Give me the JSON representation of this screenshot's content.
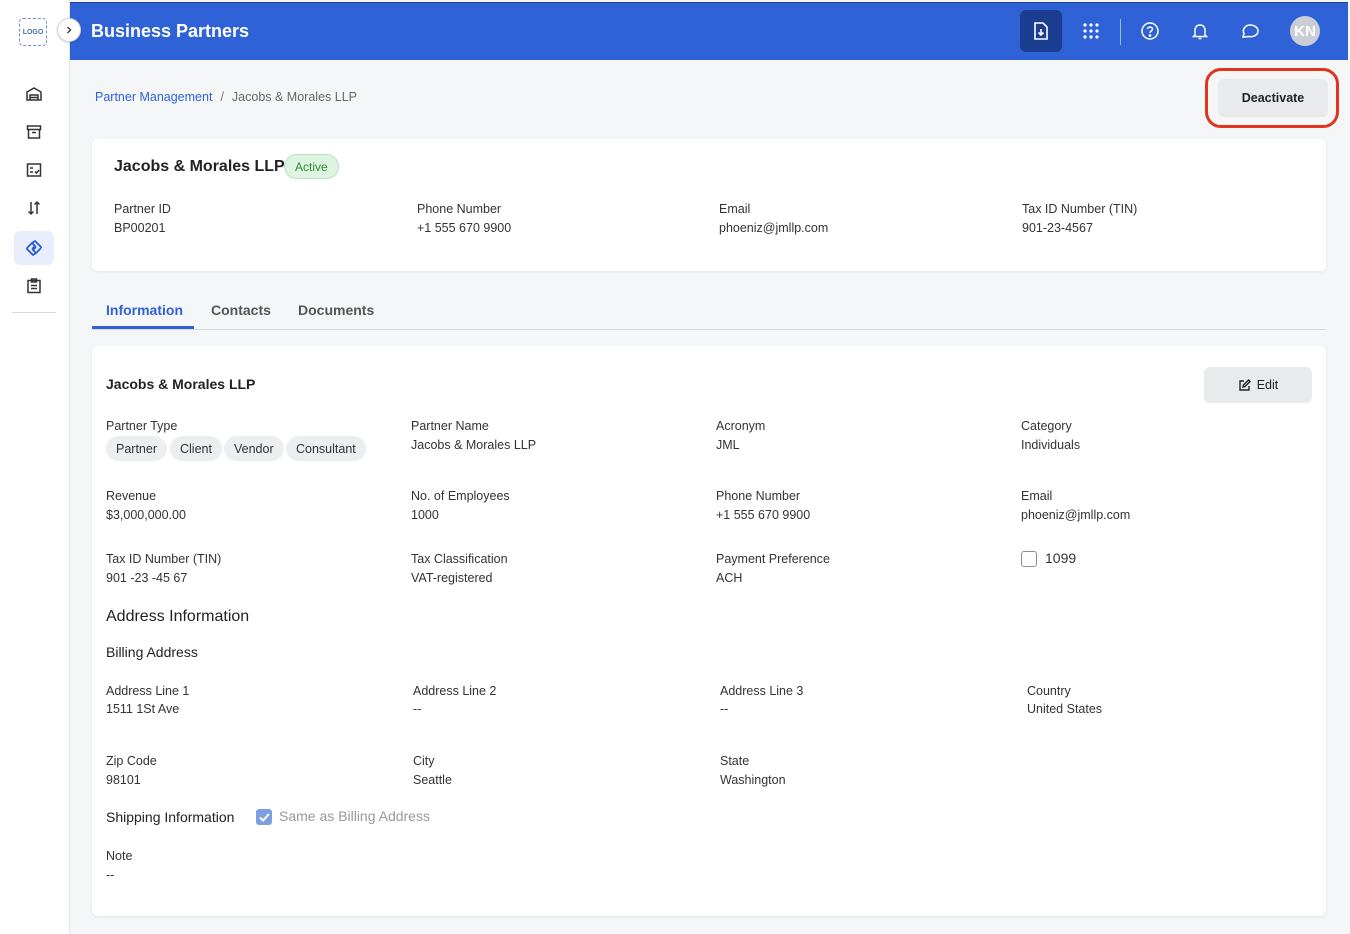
{
  "rail": {
    "logo_text": "LOGO",
    "items": [
      {
        "name": "warehouse-icon"
      },
      {
        "name": "archive-icon"
      },
      {
        "name": "checklist-icon"
      },
      {
        "name": "sort-icon"
      },
      {
        "name": "partners-icon"
      },
      {
        "name": "clipboard-icon"
      }
    ]
  },
  "header": {
    "title": "Business Partners",
    "avatar_initials": "KN",
    "accent_color": "#2f62d6"
  },
  "breadcrumb": {
    "parent": "Partner Management",
    "current": "Jacobs & Morales LLP"
  },
  "actions": {
    "deactivate_label": "Deactivate"
  },
  "summary": {
    "name": "Jacobs & Morales LLP",
    "status": "Active",
    "fields": [
      {
        "label": "Partner ID",
        "value": "BP00201"
      },
      {
        "label": "Phone Number",
        "value": "+1 555 670 9900"
      },
      {
        "label": "Email",
        "value": "phoeniz@jmllp.com"
      },
      {
        "label": "Tax ID Number (TIN)",
        "value": "901-23-4567"
      }
    ]
  },
  "tabs": [
    {
      "label": "Information",
      "active": true
    },
    {
      "label": "Contacts",
      "active": false
    },
    {
      "label": "Documents",
      "active": false
    }
  ],
  "info": {
    "title": "Jacobs & Morales LLP",
    "edit_label": "Edit",
    "partner_type_label": "Partner Type",
    "partner_types": [
      "Partner",
      "Client",
      "Vendor",
      "Consultant"
    ],
    "partner_name": {
      "label": "Partner Name",
      "value": "Jacobs & Morales LLP"
    },
    "acronym": {
      "label": "Acronym",
      "value": "JML"
    },
    "category": {
      "label": "Category",
      "value": "Individuals"
    },
    "revenue": {
      "label": "Revenue",
      "value": "$3,000,000.00"
    },
    "employees": {
      "label": "No. of Employees",
      "value": "1000"
    },
    "phone": {
      "label": "Phone Number",
      "value": "+1 555 670 9900"
    },
    "email": {
      "label": "Email",
      "value": "phoeniz@jmllp.com"
    },
    "tin": {
      "label": "Tax ID Number (TIN)",
      "value": "901 -23 -45 67"
    },
    "tax_class": {
      "label": "Tax Classification",
      "value": "VAT-registered"
    },
    "payment": {
      "label": "Payment Preference",
      "value": "ACH"
    },
    "form_1099": {
      "label": "1099",
      "checked": false
    }
  },
  "address": {
    "section_title": "Address Information",
    "billing_title": "Billing Address",
    "line1": {
      "label": "Address Line 1",
      "value": "1511 1St Ave"
    },
    "line2": {
      "label": "Address Line 2",
      "value": "--"
    },
    "line3": {
      "label": "Address Line 3",
      "value": "--"
    },
    "country": {
      "label": "Country",
      "value": "United States"
    },
    "zip": {
      "label": "Zip Code",
      "value": "98101"
    },
    "city": {
      "label": "City",
      "value": "Seattle"
    },
    "state": {
      "label": "State",
      "value": "Washington"
    },
    "shipping_title": "Shipping Information",
    "same_as_billing": {
      "label": "Same as Billing Address",
      "checked": true
    },
    "note": {
      "label": "Note",
      "value": "--"
    }
  }
}
